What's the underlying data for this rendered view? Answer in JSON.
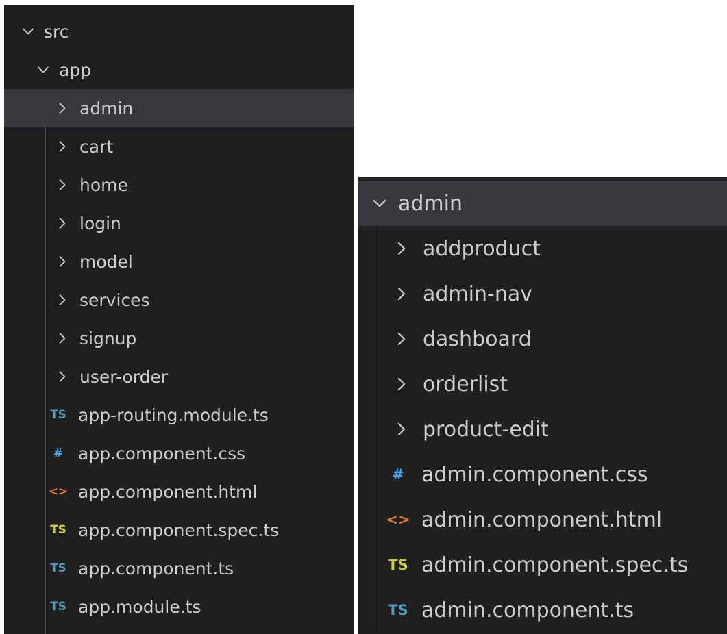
{
  "left_tree": {
    "root": {
      "label": "src",
      "expanded": true
    },
    "app": {
      "label": "app",
      "expanded": true
    },
    "folders": [
      {
        "label": "admin",
        "selected": true
      },
      {
        "label": "cart"
      },
      {
        "label": "home"
      },
      {
        "label": "login"
      },
      {
        "label": "model"
      },
      {
        "label": "services"
      },
      {
        "label": "signup"
      },
      {
        "label": "user-order"
      }
    ],
    "files": [
      {
        "label": "app-routing.module.ts",
        "icon": "typescript-icon",
        "badge": "TS",
        "color": "#519aba"
      },
      {
        "label": "app.component.css",
        "icon": "css-icon",
        "badge": "#",
        "color": "#42a5f5"
      },
      {
        "label": "app.component.html",
        "icon": "html-icon",
        "badge": "<>",
        "color": "#e37933"
      },
      {
        "label": "app.component.spec.ts",
        "icon": "typescript-spec-icon",
        "badge": "TS",
        "color": "#cbcb41"
      },
      {
        "label": "app.component.ts",
        "icon": "typescript-icon",
        "badge": "TS",
        "color": "#519aba"
      },
      {
        "label": "app.module.ts",
        "icon": "typescript-icon",
        "badge": "TS",
        "color": "#519aba"
      }
    ]
  },
  "right_tree": {
    "root": {
      "label": "admin",
      "expanded": true
    },
    "folders": [
      {
        "label": "addproduct"
      },
      {
        "label": "admin-nav"
      },
      {
        "label": "dashboard"
      },
      {
        "label": "orderlist"
      },
      {
        "label": "product-edit"
      }
    ],
    "files": [
      {
        "label": "admin.component.css",
        "icon": "css-icon",
        "badge": "#",
        "color": "#42a5f5"
      },
      {
        "label": "admin.component.html",
        "icon": "html-icon",
        "badge": "<>",
        "color": "#e37933"
      },
      {
        "label": "admin.component.spec.ts",
        "icon": "typescript-spec-icon",
        "badge": "TS",
        "color": "#cbcb41"
      },
      {
        "label": "admin.component.ts",
        "icon": "typescript-icon",
        "badge": "TS",
        "color": "#519aba"
      }
    ]
  },
  "colors": {
    "background": "#1f1f1f",
    "selected_row": "#37373d",
    "text": "#cccccc",
    "indent_guide": "#4a4a4a"
  }
}
